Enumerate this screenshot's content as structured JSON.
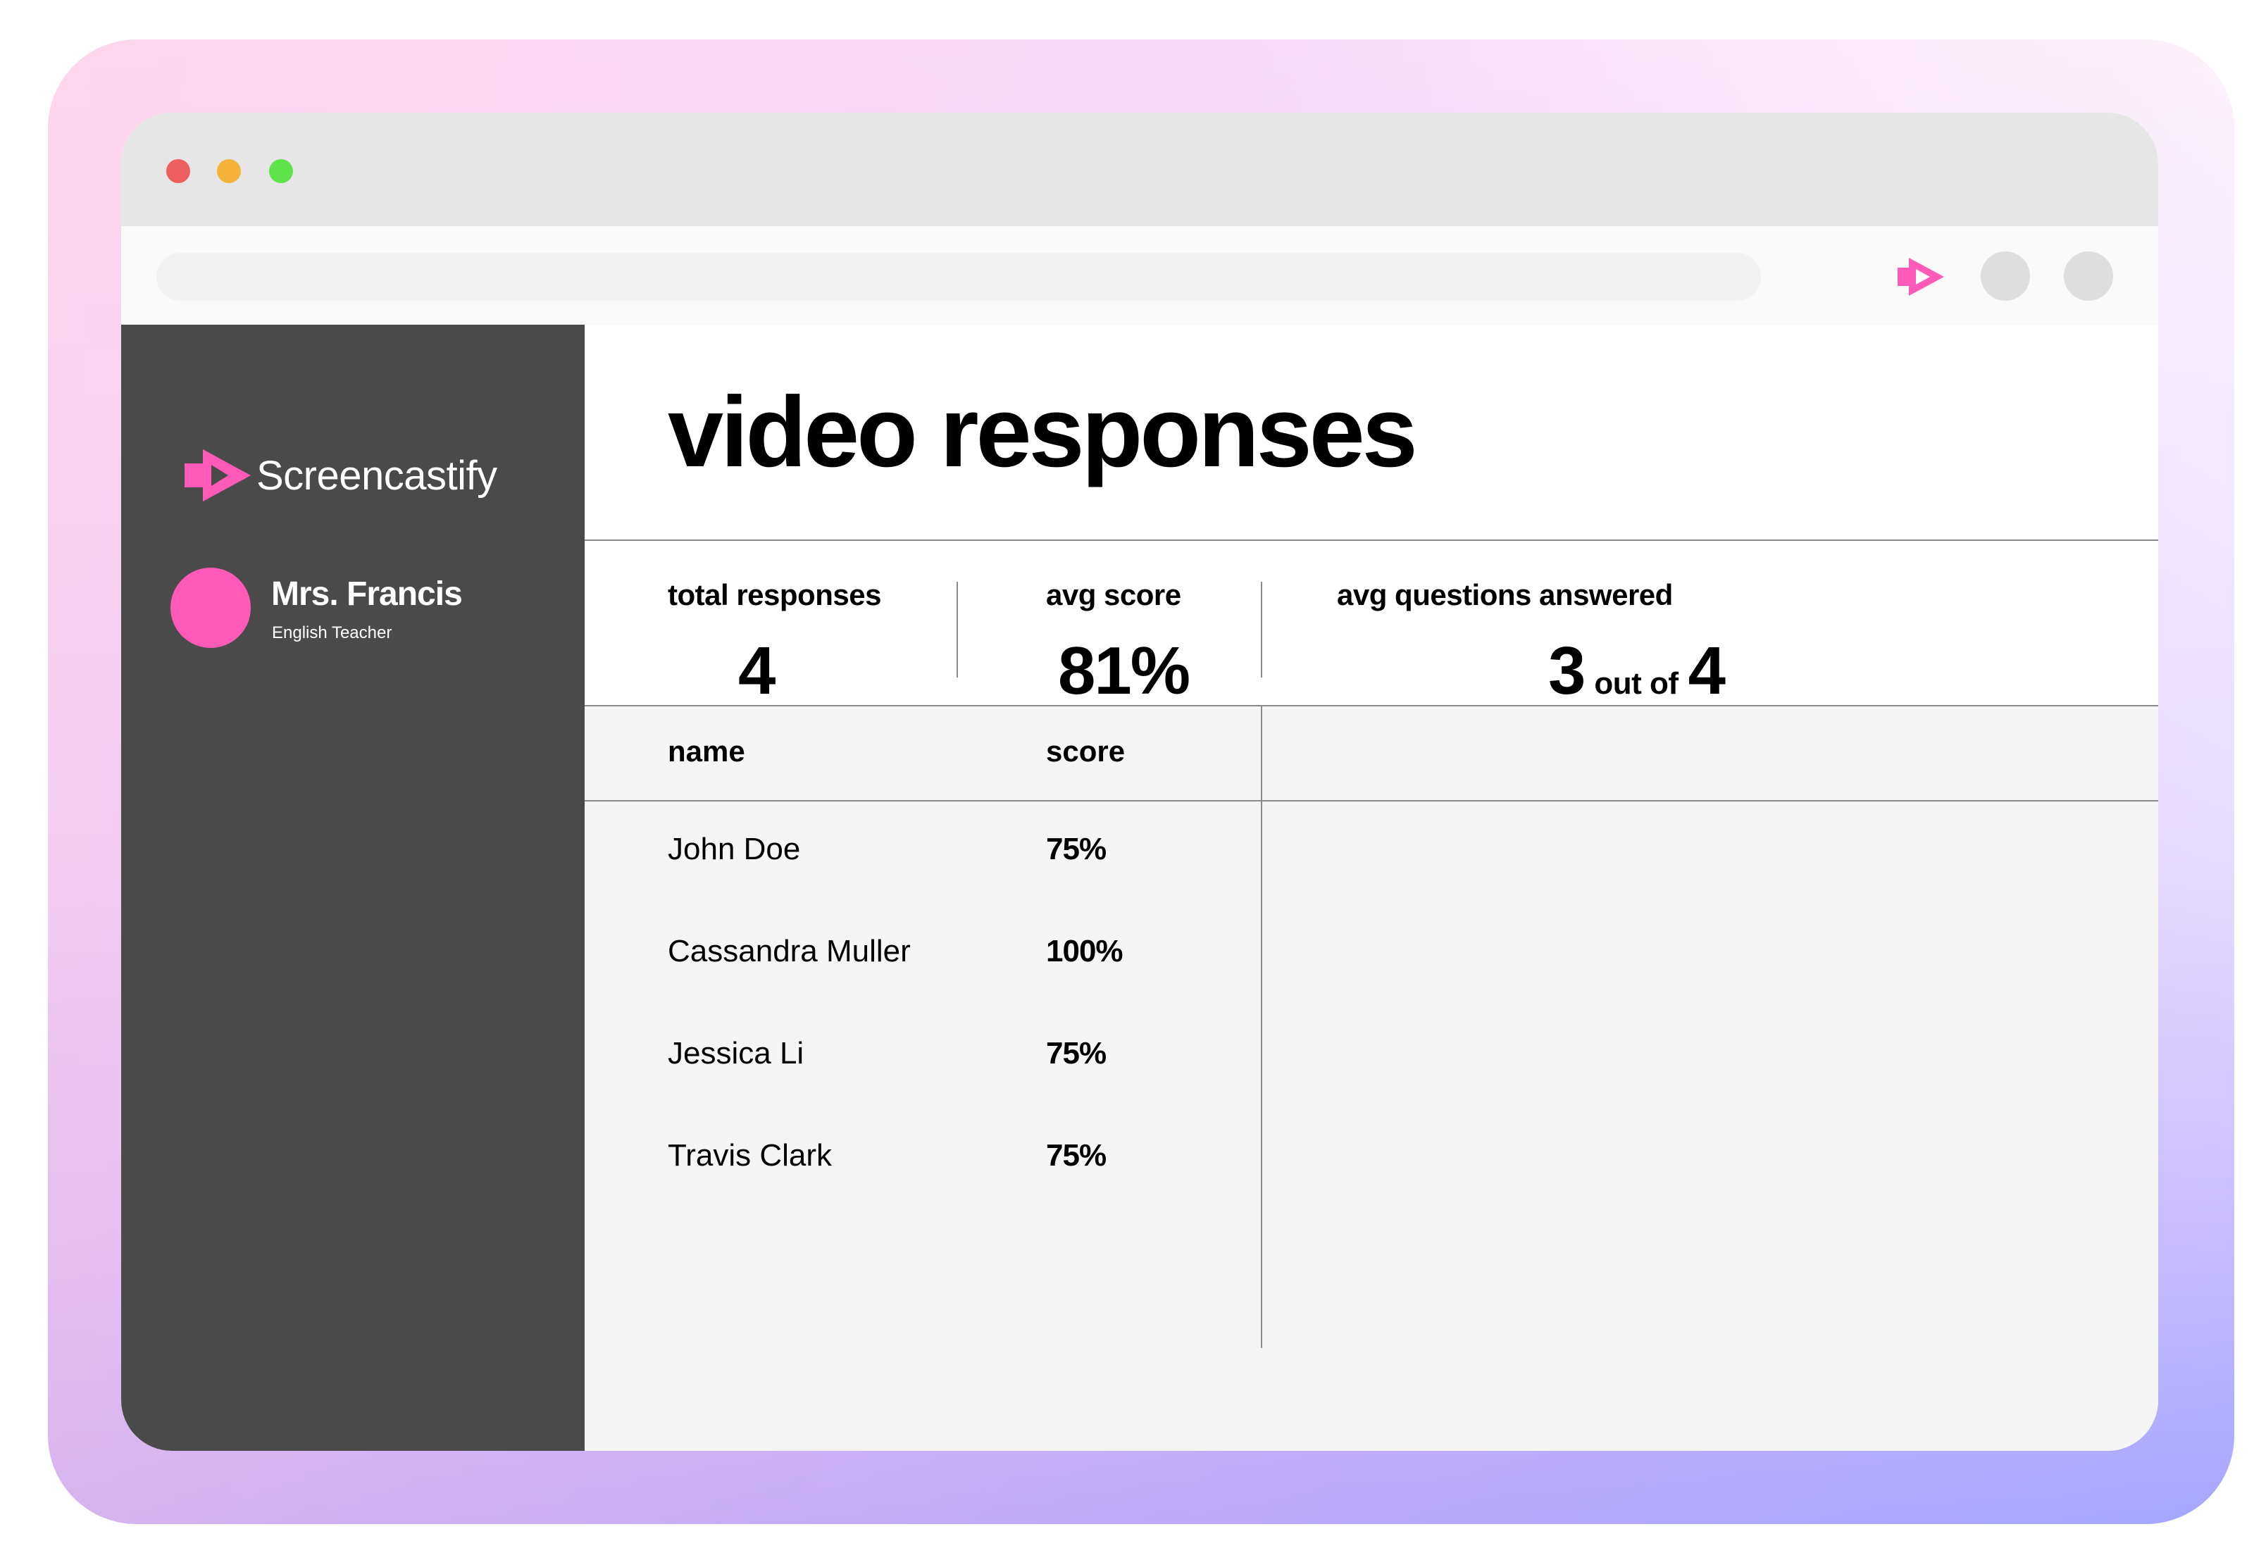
{
  "window": {
    "traffic_lights": [
      "#ec5f5e",
      "#f5b33b",
      "#5fe34a"
    ]
  },
  "toolbar": {
    "extension_icon": "screencastify-icon",
    "buttons": [
      "profile-button",
      "menu-button"
    ]
  },
  "sidebar": {
    "brand": "Screencastify",
    "user": {
      "name": "Mrs. Francis",
      "role": "English Teacher",
      "avatar_color": "#ff5ab8"
    }
  },
  "main": {
    "title": "video responses",
    "stats": {
      "total_responses": {
        "label": "total responses",
        "value": "4"
      },
      "avg_score": {
        "label": "avg score",
        "value": "81%"
      },
      "avg_questions": {
        "label": "avg questions answered",
        "answered": "3",
        "connector": "out of",
        "total": "4"
      }
    },
    "table": {
      "columns": {
        "name": "name",
        "score": "score"
      },
      "rows": [
        {
          "name": "John Doe",
          "score": "75%"
        },
        {
          "name": "Cassandra Muller",
          "score": "100%"
        },
        {
          "name": "Jessica Li",
          "score": "75%"
        },
        {
          "name": "Travis Clark",
          "score": "75%"
        }
      ]
    }
  },
  "colors": {
    "accent": "#ff5ab8",
    "sidebar": "#4a4a4a"
  }
}
